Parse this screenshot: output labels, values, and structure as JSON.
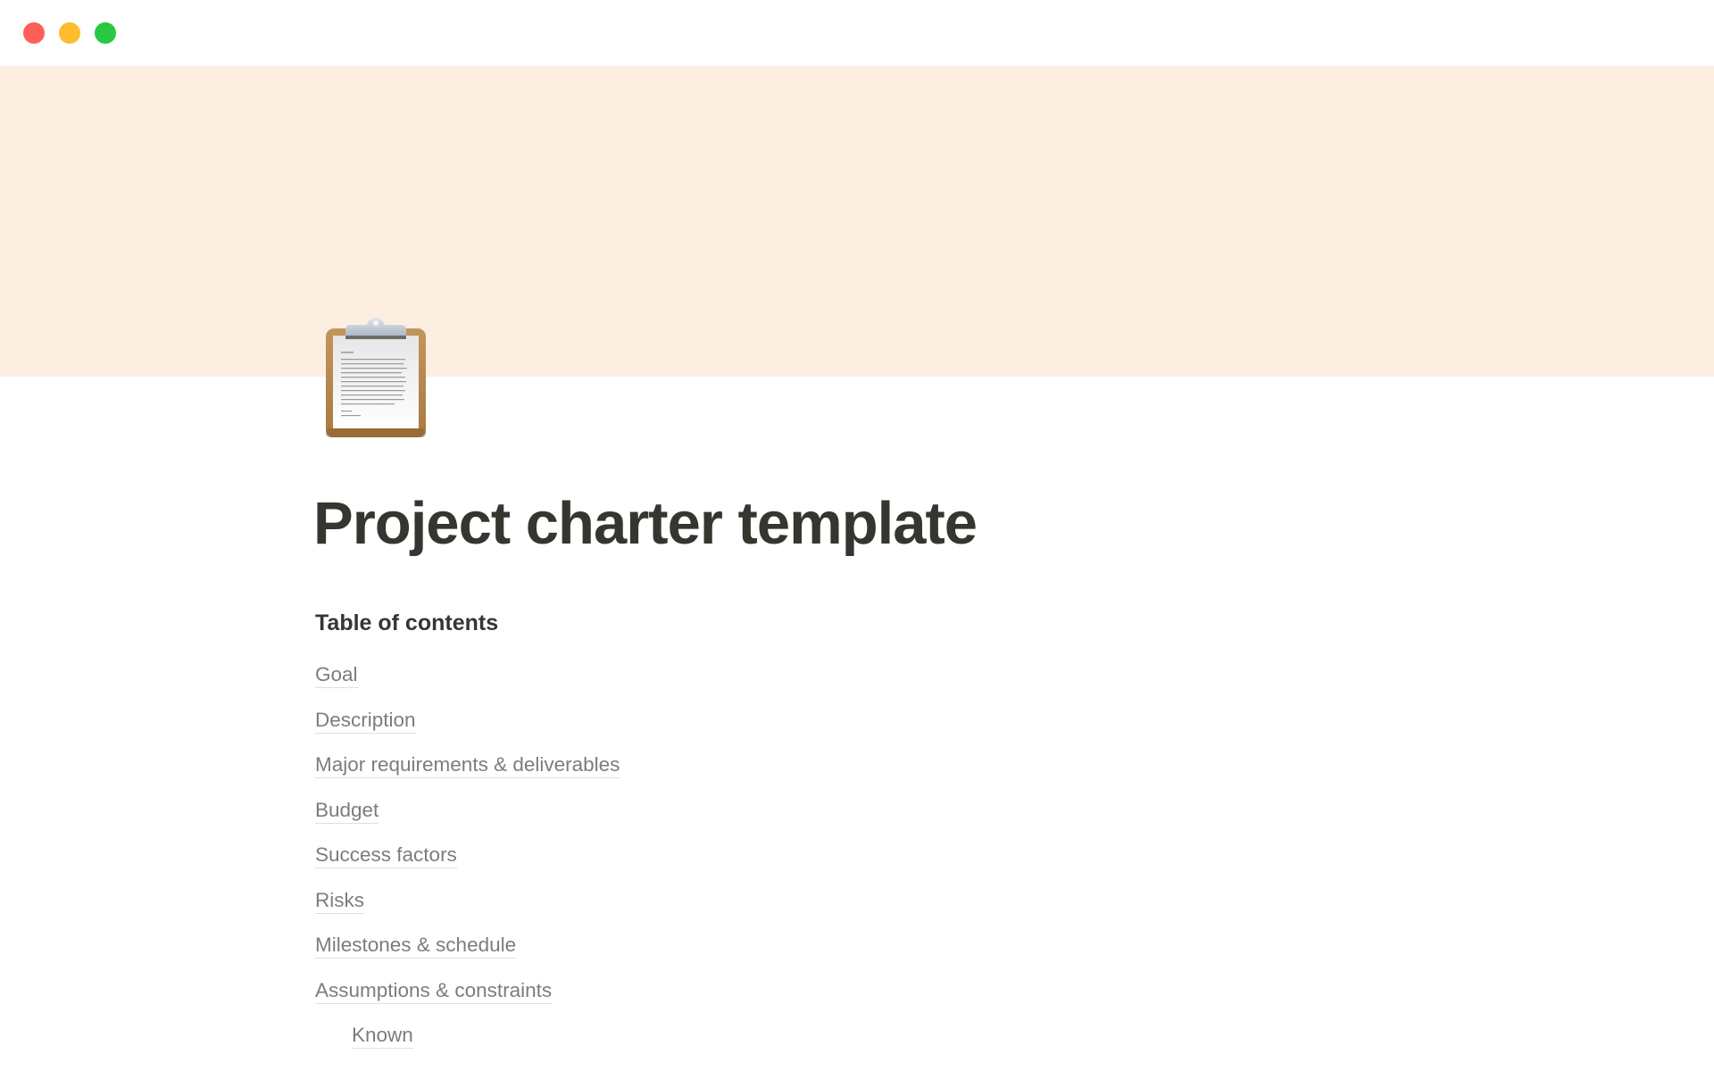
{
  "window": {
    "controls": [
      {
        "name": "close",
        "color": "#fe5f57"
      },
      {
        "name": "minimize",
        "color": "#febc2e"
      },
      {
        "name": "maximize",
        "color": "#28c840"
      }
    ]
  },
  "cover": {
    "color": "#fdeee2"
  },
  "page": {
    "icon": "clipboard-icon",
    "title": "Project charter template"
  },
  "toc": {
    "heading": "Table of contents",
    "items": [
      {
        "label": "Goal",
        "level": 0
      },
      {
        "label": "Description",
        "level": 0
      },
      {
        "label": "Major requirements & deliverables",
        "level": 0
      },
      {
        "label": "Budget",
        "level": 0
      },
      {
        "label": "Success factors",
        "level": 0
      },
      {
        "label": "Risks",
        "level": 0
      },
      {
        "label": "Milestones & schedule",
        "level": 0
      },
      {
        "label": "Assumptions & constraints",
        "level": 0
      },
      {
        "label": "Known",
        "level": 1
      }
    ]
  }
}
